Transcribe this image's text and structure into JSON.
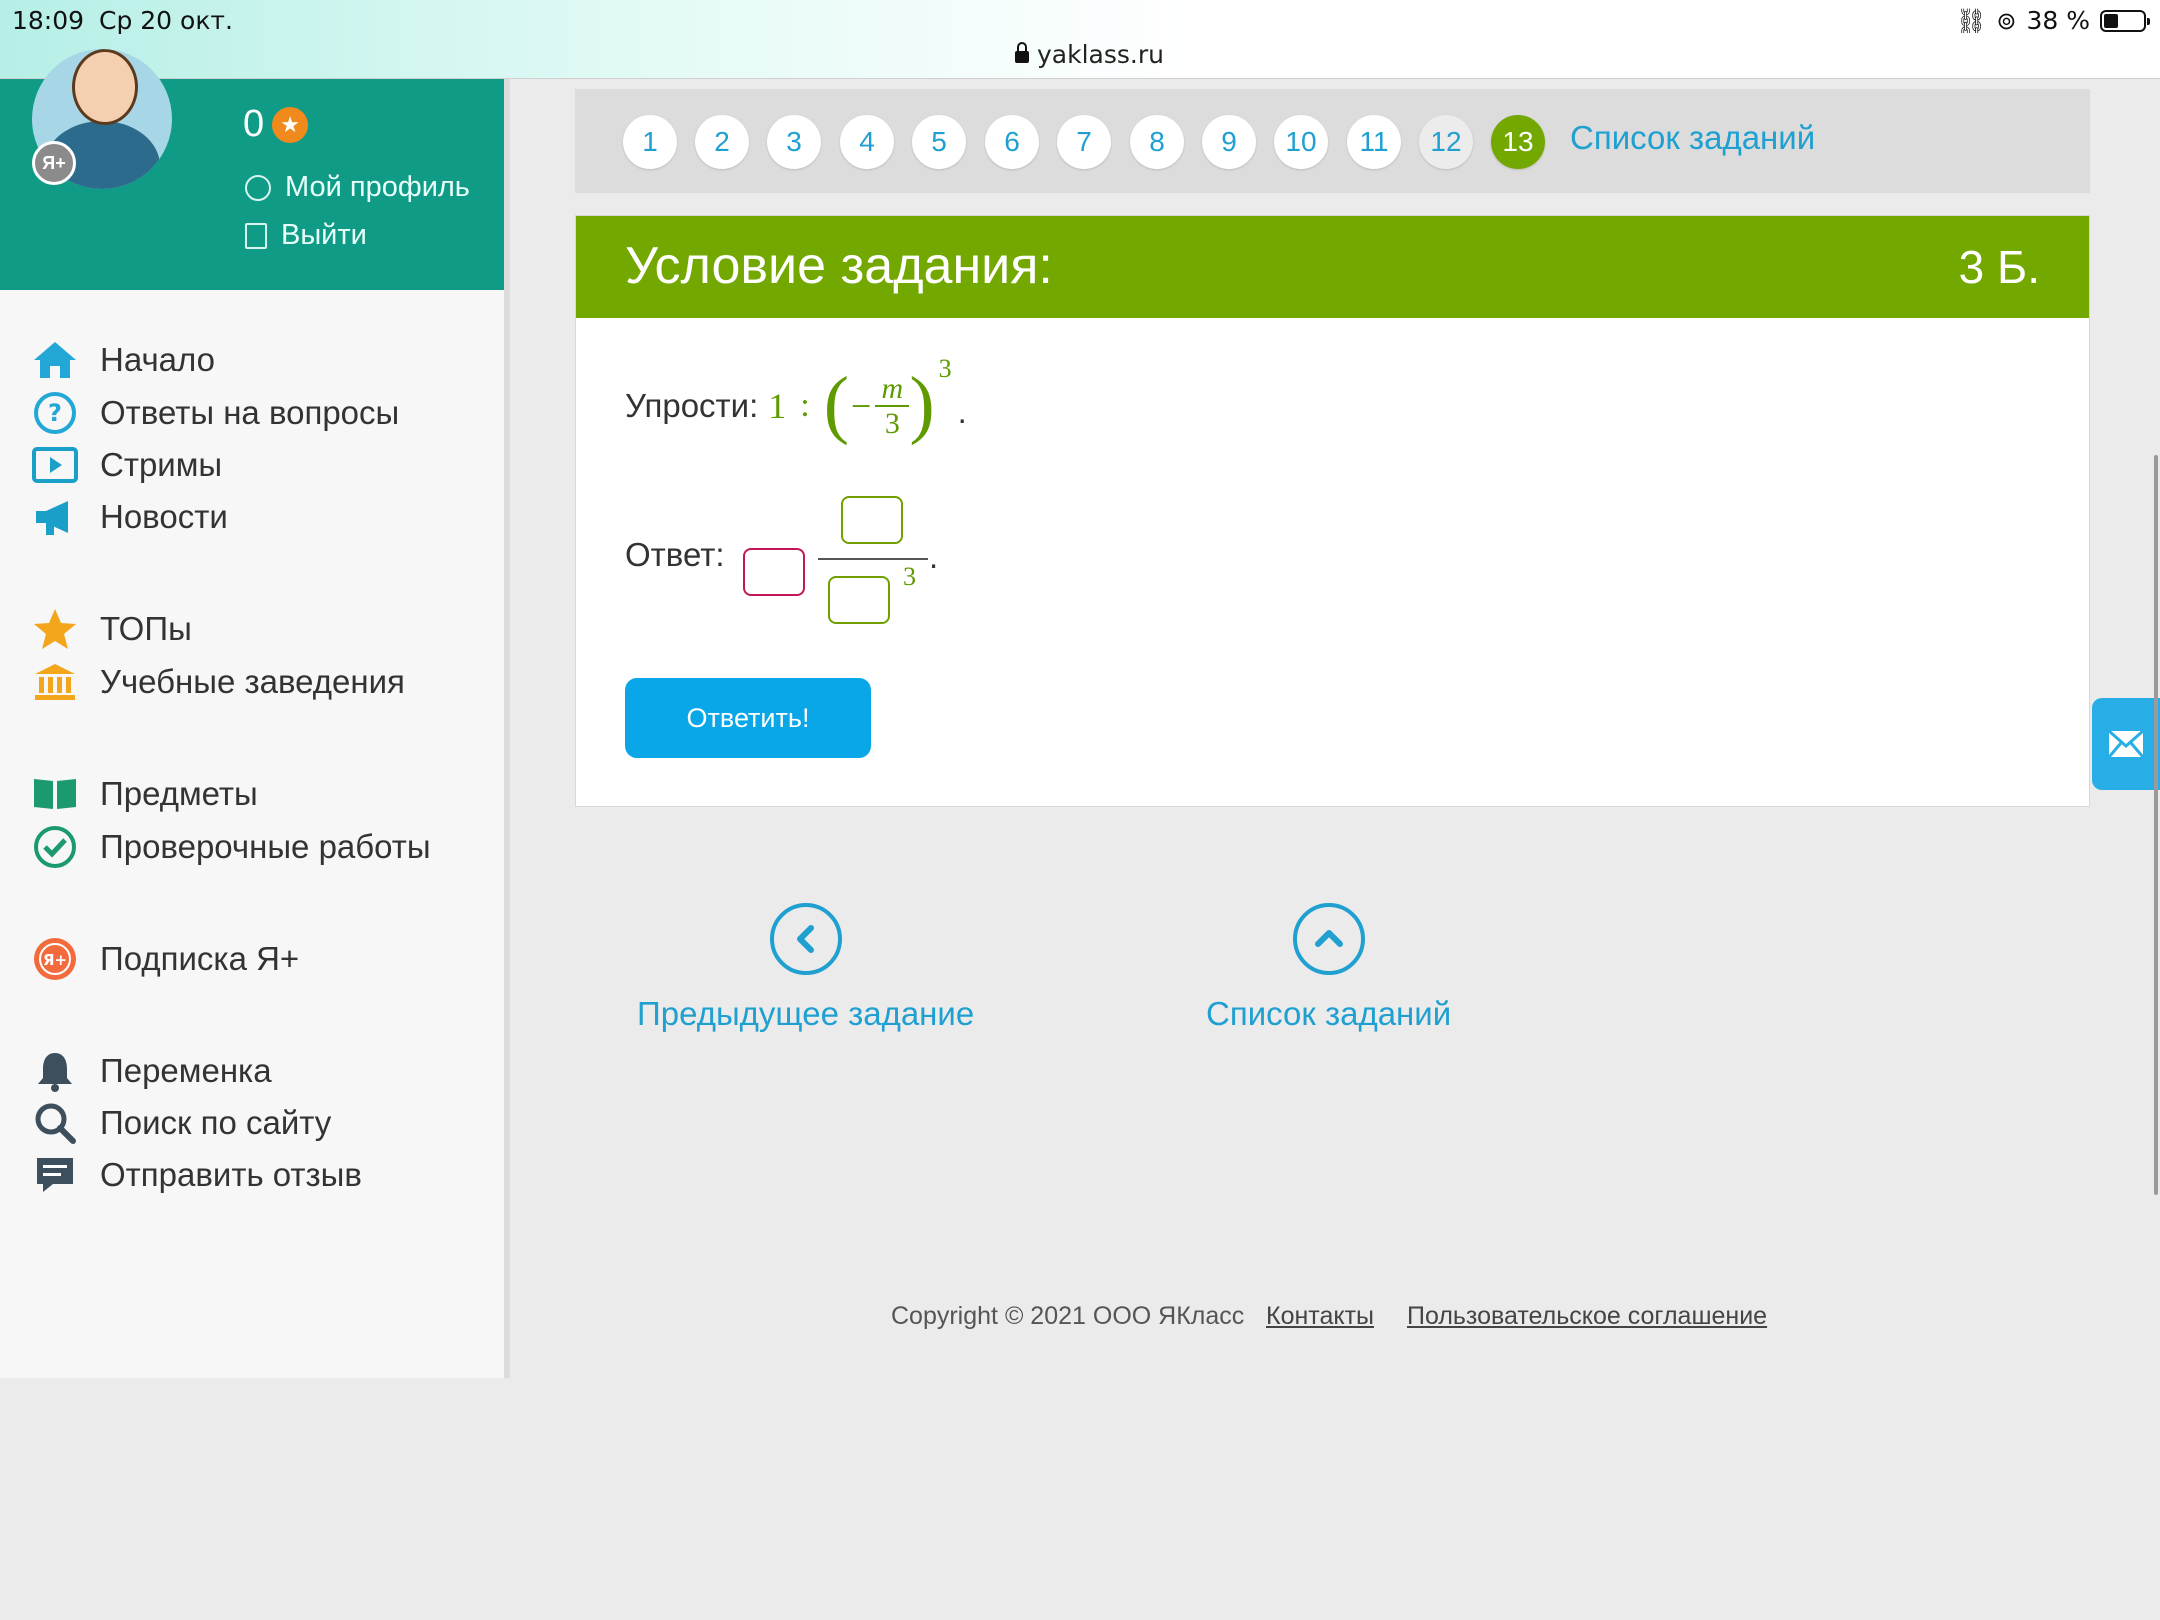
{
  "status_bar": {
    "time": "18:09",
    "date": "Ср 20 окт.",
    "url": "yaklass.ru",
    "battery": "38 %"
  },
  "profile": {
    "badge": "Я+",
    "points": "0",
    "my_profile": "Мой профиль",
    "logout": "Выйти"
  },
  "nav": {
    "home": "Начало",
    "answers": "Ответы на вопросы",
    "streams": "Стримы",
    "news": "Новости",
    "tops": "ТОПы",
    "schools": "Учебные заведения",
    "subjects": "Предметы",
    "tests": "Проверочные работы",
    "subscription": "Подписка Я+",
    "break": "Переменка",
    "search": "Поиск по сайту",
    "feedback": "Отправить отзыв"
  },
  "pager": {
    "pages": [
      "1",
      "2",
      "3",
      "4",
      "5",
      "6",
      "7",
      "8",
      "9",
      "10",
      "11",
      "12",
      "13"
    ],
    "current": "13",
    "list_link": "Список заданий"
  },
  "task": {
    "header_title": "Условие задания:",
    "score": "3 Б.",
    "prompt": "Упрости:",
    "expr_one": "1",
    "expr_colon": ":",
    "expr_minus": "−",
    "expr_num": "m",
    "expr_den": "3",
    "expr_power": "3",
    "answer_label": "Ответ:",
    "answer_power": "3",
    "submit": "Ответить!"
  },
  "bottom_nav": {
    "prev": "Предыдущее задание",
    "list": "Список заданий"
  },
  "footer": {
    "copyright": "Copyright © 2021 ООО ЯКласс",
    "contacts": "Контакты",
    "agreement": "Пользовательское соглашение"
  },
  "colors": {
    "teal": "#0f9b86",
    "green": "#72a800",
    "blue": "#0aa7e8",
    "link": "#1fa0d0"
  }
}
